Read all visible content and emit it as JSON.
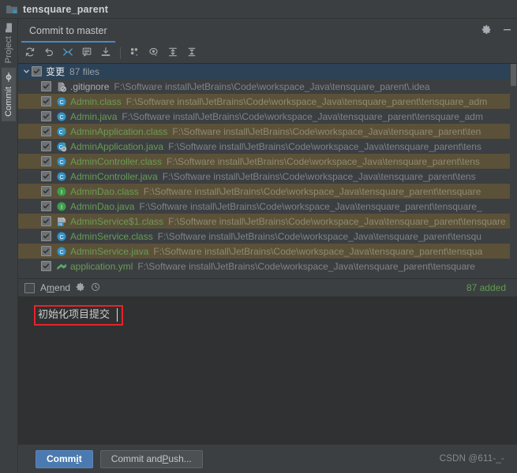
{
  "window": {
    "title": "tensquare_parent",
    "project_icon": "project-folder-icon",
    "settings_icon": "gear-icon",
    "minimize_icon": "minimize-icon"
  },
  "rail": {
    "tabs": [
      {
        "label": "Project",
        "icon": "folder-icon",
        "active": false
      },
      {
        "label": "Commit",
        "icon": "commit-node-icon",
        "active": true
      }
    ]
  },
  "tabs": [
    {
      "label": "Commit to master",
      "active": true
    }
  ],
  "toolbar": {
    "buttons": [
      {
        "name": "refresh-icon",
        "title": "Refresh"
      },
      {
        "name": "rollback-icon",
        "title": "Rollback"
      },
      {
        "name": "show-diff-icon",
        "title": "Show Diff"
      },
      {
        "name": "commit-message-icon",
        "title": "Commit Message History"
      },
      {
        "name": "update-project-icon",
        "title": "Update Project"
      },
      {
        "name": "group-by-icon",
        "title": "Group By"
      },
      {
        "name": "preview-diff-icon",
        "title": "Preview Diff"
      },
      {
        "name": "expand-all-icon",
        "title": "Expand All"
      },
      {
        "name": "collapse-all-icon",
        "title": "Collapse All"
      }
    ]
  },
  "changes": {
    "header": {
      "label": "变更",
      "count": "87 files",
      "checked": true,
      "expanded": true
    },
    "files": [
      {
        "name": ".gitignore",
        "path": "F:\\Software install\\JetBrains\\Code\\workspace_Java\\tensquare_parent\\.idea",
        "icon": "gitignore-file-icon",
        "checked": true,
        "name_color": "plain"
      },
      {
        "name": "Admin.class",
        "path": "F:\\Software install\\JetBrains\\Code\\workspace_Java\\tensquare_parent\\tensquare_adm",
        "icon": "java-class-icon",
        "checked": true,
        "name_color": "green"
      },
      {
        "name": "Admin.java",
        "path": "F:\\Software install\\JetBrains\\Code\\workspace_Java\\tensquare_parent\\tensquare_adm",
        "icon": "java-class-icon",
        "checked": true,
        "name_color": "green"
      },
      {
        "name": "AdminApplication.class",
        "path": "F:\\Software install\\JetBrains\\Code\\workspace_Java\\tensquare_parent\\ten",
        "icon": "java-runnable-class-icon",
        "checked": true,
        "name_color": "green"
      },
      {
        "name": "AdminApplication.java",
        "path": "F:\\Software install\\JetBrains\\Code\\workspace_Java\\tensquare_parent\\tens",
        "icon": "spring-boot-class-icon",
        "checked": true,
        "name_color": "green"
      },
      {
        "name": "AdminController.class",
        "path": "F:\\Software install\\JetBrains\\Code\\workspace_Java\\tensquare_parent\\tens",
        "icon": "java-class-icon",
        "checked": true,
        "name_color": "green"
      },
      {
        "name": "AdminController.java",
        "path": "F:\\Software install\\JetBrains\\Code\\workspace_Java\\tensquare_parent\\tens",
        "icon": "java-class-icon",
        "checked": true,
        "name_color": "green"
      },
      {
        "name": "AdminDao.class",
        "path": "F:\\Software install\\JetBrains\\Code\\workspace_Java\\tensquare_parent\\tensquare",
        "icon": "java-interface-icon",
        "checked": true,
        "name_color": "green"
      },
      {
        "name": "AdminDao.java",
        "path": "F:\\Software install\\JetBrains\\Code\\workspace_Java\\tensquare_parent\\tensquare_",
        "icon": "java-interface-icon",
        "checked": true,
        "name_color": "green"
      },
      {
        "name": "AdminService$1.class",
        "path": "F:\\Software install\\JetBrains\\Code\\workspace_Java\\tensquare_parent\\tensquare",
        "icon": "anonymous-class-icon",
        "checked": true,
        "name_color": "green"
      },
      {
        "name": "AdminService.class",
        "path": "F:\\Software install\\JetBrains\\Code\\workspace_Java\\tensquare_parent\\tensqu",
        "icon": "java-class-icon",
        "checked": true,
        "name_color": "green"
      },
      {
        "name": "AdminService.java",
        "path": "F:\\Software install\\JetBrains\\Code\\workspace_Java\\tensquare_parent\\tensqua",
        "icon": "java-class-icon",
        "checked": true,
        "name_color": "green"
      },
      {
        "name": "application.yml",
        "path": "F:\\Software install\\JetBrains\\Code\\workspace_Java\\tensquare_parent\\tensquare",
        "icon": "yaml-file-icon",
        "checked": true,
        "name_color": "green"
      }
    ]
  },
  "amend": {
    "label": "Amend",
    "label_prefix": "A",
    "label_underlined": "m",
    "label_suffix": "end",
    "checked": false,
    "gear_icon": "gear-icon",
    "history_icon": "history-clock-icon",
    "added_text": "87 added"
  },
  "commit_message": {
    "value": "初始化项目提交",
    "highlighted": true,
    "highlight_color": "#e8222a"
  },
  "footer": {
    "commit_button": {
      "prefix": "Comm",
      "underlined": "i",
      "suffix": "t"
    },
    "commit_push_button": {
      "prefix": "Commit and ",
      "underlined": "P",
      "suffix": "ush..."
    },
    "watermark": "CSDN @611-_-"
  },
  "colors": {
    "accent": "#4a88c7",
    "added": "#5f9c4e",
    "selection": "#2c4257",
    "stripe": "#5b5139",
    "background": "#3c3f41"
  }
}
